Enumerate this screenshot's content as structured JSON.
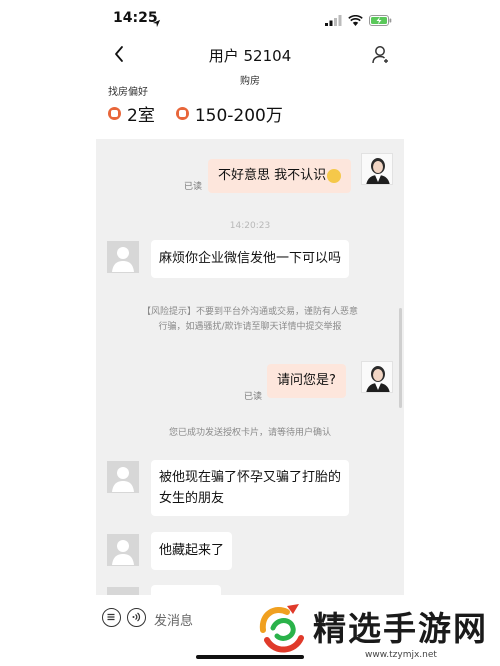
{
  "status_bar": {
    "time": "14:25"
  },
  "nav": {
    "title": "用户 52104",
    "subtitle": "购房"
  },
  "preferences": {
    "label": "找房偏好",
    "rooms": "2室",
    "price": "150-200万"
  },
  "messages": [
    {
      "side": "me",
      "text": "不好意思 我不认识",
      "status": "已读"
    },
    {
      "type": "time",
      "text": "14:20:23"
    },
    {
      "side": "other",
      "text": "麻烦你企业微信发他一下可以吗"
    },
    {
      "type": "system",
      "line1": "【风险提示】不要到平台外沟通或交易，谨防有人恶意",
      "line2": "行骗，如遇骚扰/欺诈请至聊天详情中提交举报"
    },
    {
      "side": "me",
      "text": "请问您是?",
      "status": "已读"
    },
    {
      "type": "system",
      "text": "您已成功发送授权卡片，请等待用户确认"
    },
    {
      "side": "other",
      "line1": "被他现在骗了怀孕又骗了打胎的",
      "line2": "女生的朋友"
    },
    {
      "side": "other",
      "text": "他藏起来了"
    }
  ],
  "input": {
    "placeholder": "发消息"
  },
  "watermark": {
    "text": "精选手游网",
    "url": "www.tzymjx.net"
  },
  "colors": {
    "accent": "#e8663a",
    "my_bubble": "#fde6dc",
    "chat_bg": "#f0f0f0"
  }
}
